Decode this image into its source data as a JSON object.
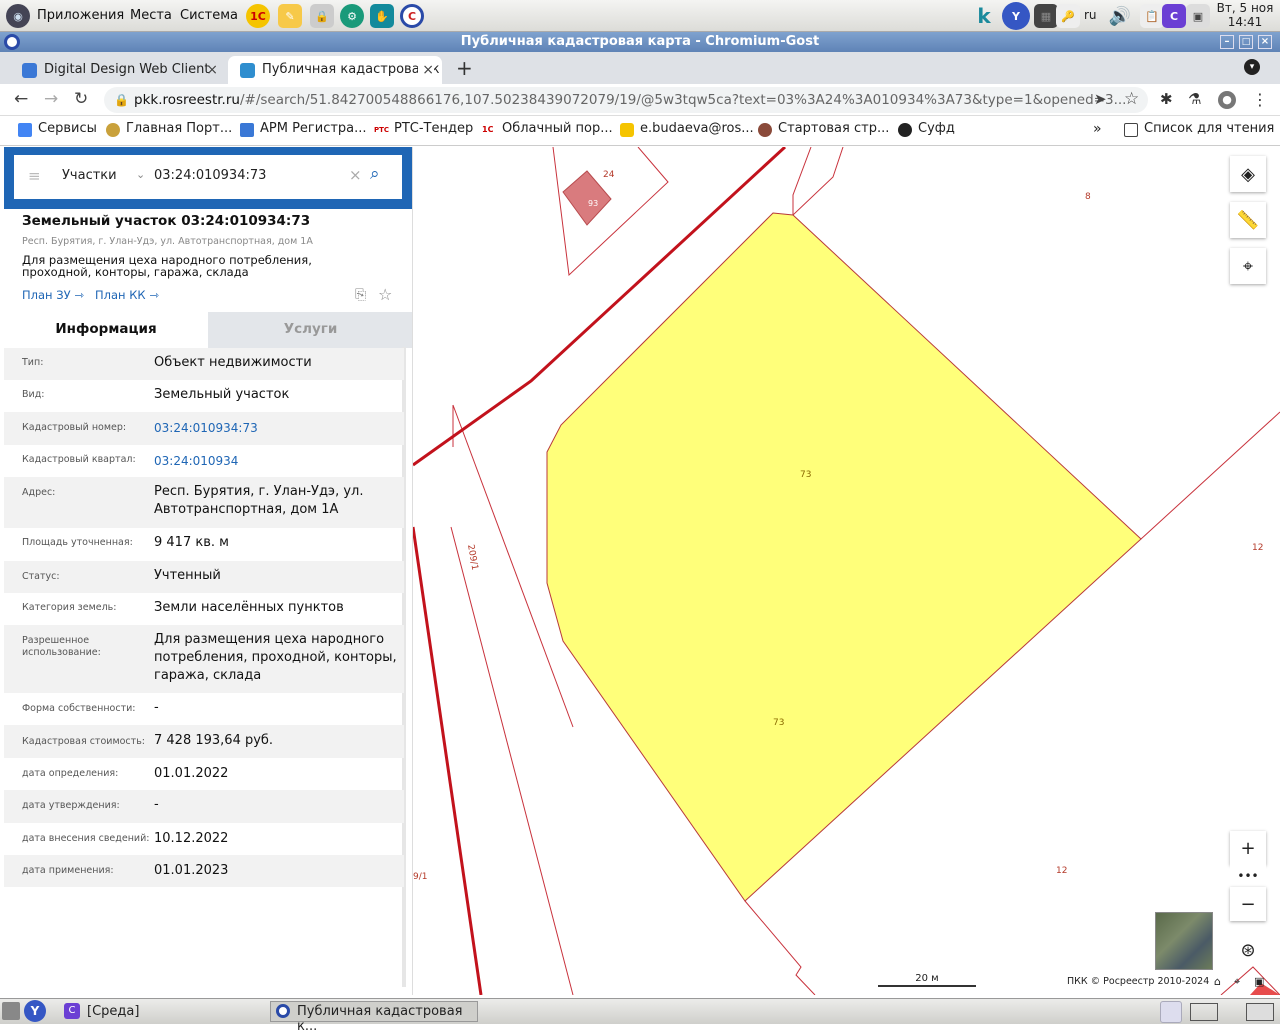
{
  "desktop": {
    "menu": [
      "Приложения",
      "Места",
      "Система"
    ],
    "lang": "ru",
    "clock_date": "Вт, 5 ноя",
    "clock_time": "14:41"
  },
  "window": {
    "title": "Публичная кадастровая карта - Chromium-Gost"
  },
  "tabs": [
    {
      "label": "Digital Design Web Client",
      "active": false
    },
    {
      "label": "Публичная кадастровая к",
      "active": true
    }
  ],
  "address": {
    "host": "pkk.rosreestr.ru",
    "path": "/#/search/51.842700548866176,107.50238439072079/19/@5w3tqw5ca?text=03%3A24%3A010934%3A73&type=1&opened=3..."
  },
  "bookmarks": [
    "Сервисы",
    "Главная Порт...",
    "АРМ Регистра...",
    "РТС-Тендер",
    "Облачный пор...",
    "e.budaeva@ros...",
    "Стартовая стр...",
    "Суфд"
  ],
  "bookmarks_more": "»",
  "reading_list": "Список для чтения",
  "search": {
    "category": "Участки",
    "query": "03:24:010934:73"
  },
  "parcel": {
    "title": "Земельный участок 03:24:010934:73",
    "address_small": "Респ. Бурятия, г. Улан-Удэ, ул. Автотранспортная, дом 1А",
    "purpose": "Для размещения цеха народного потребления, проходной, конторы, гаража, склада",
    "plan_zu": "План ЗУ",
    "plan_kk": "План КК"
  },
  "info_tabs": [
    "Информация",
    "Услуги"
  ],
  "fields": [
    {
      "k": "Тип:",
      "v": "Объект недвижимости"
    },
    {
      "k": "Вид:",
      "v": "Земельный участок"
    },
    {
      "k": "Кадастровый номер:",
      "v": "03:24:010934:73",
      "link": true
    },
    {
      "k": "Кадастровый квартал:",
      "v": "03:24:010934",
      "link": true
    },
    {
      "k": "Адрес:",
      "v": "Респ. Бурятия, г. Улан-Удэ, ул.",
      "v2": "Автотранспортная, дом 1А"
    },
    {
      "k": "Площадь уточненная:",
      "v": "9 417 кв. м"
    },
    {
      "k": "Статус:",
      "v": "Учтенный"
    },
    {
      "k": "Категория земель:",
      "v": "Земли населённых пунктов"
    },
    {
      "k": "Разрешенное",
      "k2": "использование:",
      "v": "Для размещения цеха народного",
      "v2": "потребления, проходной, конторы,",
      "v3": "гаража, склада"
    },
    {
      "k": "Форма собственности:",
      "v": "-"
    },
    {
      "k": "Кадастровая стоимость:",
      "v": "7 428 193,64 руб."
    },
    {
      "k": "дата определения:",
      "v": "01.01.2022"
    },
    {
      "k": "дата утверждения:",
      "v": "-"
    },
    {
      "k": "дата внесения сведений:",
      "v": "10.12.2022"
    },
    {
      "k": "дата применения:",
      "v": "01.01.2023"
    }
  ],
  "map": {
    "labels": [
      "24",
      "93",
      "8",
      "73",
      "73",
      "12",
      "12",
      "209/1",
      "9/1"
    ],
    "scale": "20 м",
    "copyright": "ПКК © Росреестр 2010-2024"
  },
  "taskbar": {
    "items": [
      "[Среда]",
      "Публичная кадастровая к..."
    ]
  }
}
